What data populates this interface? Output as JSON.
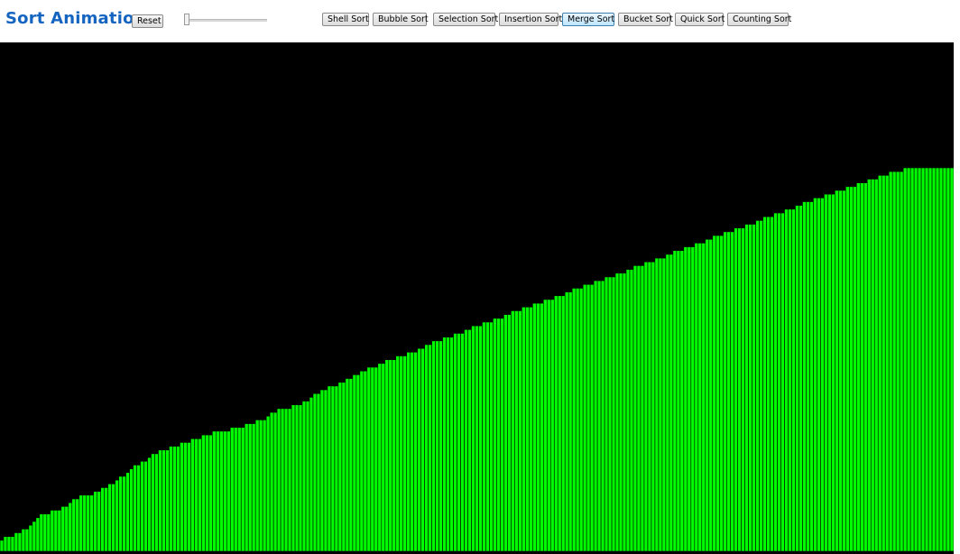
{
  "app": {
    "title": "Sort Animation"
  },
  "controls": {
    "reset_label": "Reset",
    "speed_slider_value": 0,
    "buttons": [
      {
        "label": "Shell Sort",
        "active": false
      },
      {
        "label": "Bubble Sort",
        "active": false
      },
      {
        "label": "Selection Sort",
        "active": false
      },
      {
        "label": "Insertion Sort",
        "active": false
      },
      {
        "label": "Merge Sort",
        "active": true
      },
      {
        "label": "Bucket Sort",
        "active": false
      },
      {
        "label": "Quick Sort",
        "active": false
      },
      {
        "label": "Counting Sort",
        "active": false
      }
    ]
  },
  "colors": {
    "title": "#1565c0",
    "canvas_background": "#000000",
    "bar_fill": "#00ff00",
    "bar_outline": "#000000"
  },
  "chart_data": {
    "type": "bar",
    "description_state": "sorted ascending",
    "bar_count": 261,
    "value_range": [
      0,
      100
    ],
    "values": [
      1,
      2,
      2,
      2,
      3,
      3,
      4,
      4,
      5,
      6,
      7,
      8,
      8,
      8,
      9,
      9,
      9,
      10,
      10,
      11,
      12,
      12,
      13,
      13,
      13,
      13,
      14,
      14,
      15,
      15,
      16,
      16,
      17,
      18,
      18,
      19,
      20,
      21,
      21,
      22,
      22,
      23,
      24,
      24,
      25,
      25,
      25,
      26,
      26,
      26,
      27,
      27,
      27,
      28,
      28,
      28,
      29,
      29,
      29,
      30,
      30,
      30,
      30,
      30,
      31,
      31,
      31,
      31,
      32,
      32,
      32,
      33,
      33,
      33,
      34,
      35,
      35,
      36,
      36,
      36,
      36,
      37,
      37,
      37,
      38,
      38,
      39,
      40,
      40,
      41,
      41,
      42,
      42,
      42,
      43,
      43,
      44,
      44,
      45,
      45,
      46,
      46,
      47,
      47,
      47,
      48,
      48,
      49,
      49,
      49,
      50,
      50,
      50,
      51,
      51,
      51,
      52,
      52,
      53,
      53,
      54,
      54,
      54,
      55,
      55,
      55,
      56,
      56,
      56,
      57,
      57,
      58,
      58,
      58,
      59,
      59,
      59,
      60,
      60,
      60,
      61,
      61,
      62,
      62,
      62,
      63,
      63,
      63,
      64,
      64,
      64,
      65,
      65,
      65,
      66,
      66,
      66,
      67,
      67,
      68,
      68,
      68,
      69,
      69,
      69,
      70,
      70,
      70,
      71,
      71,
      71,
      72,
      72,
      72,
      73,
      73,
      74,
      74,
      74,
      75,
      75,
      75,
      76,
      76,
      76,
      77,
      77,
      78,
      78,
      78,
      79,
      79,
      79,
      80,
      80,
      80,
      81,
      81,
      82,
      82,
      82,
      83,
      83,
      83,
      84,
      84,
      84,
      85,
      85,
      85,
      86,
      86,
      87,
      87,
      87,
      88,
      88,
      88,
      89,
      89,
      89,
      90,
      90,
      91,
      91,
      91,
      92,
      92,
      92,
      93,
      93,
      93,
      94,
      94,
      94,
      95,
      95,
      95,
      96,
      96,
      96,
      97,
      97,
      97,
      98,
      98,
      98,
      99,
      99,
      99,
      99,
      100,
      100,
      100,
      100,
      100,
      100,
      100,
      100,
      100,
      100,
      100,
      100,
      100,
      100
    ]
  }
}
